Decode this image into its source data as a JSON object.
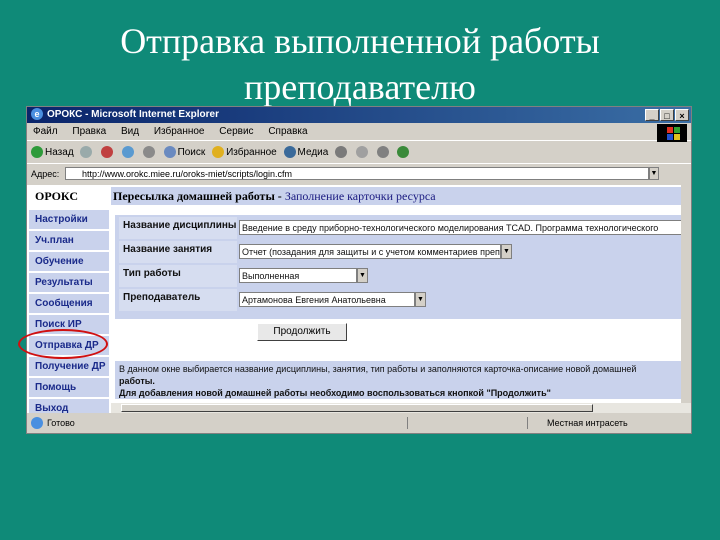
{
  "slide": {
    "title_line1": "Отправка выполненной работы",
    "title_line2": "преподавателю"
  },
  "window": {
    "title": "ОРОКС - Microsoft Internet Explorer",
    "menu": [
      "Файл",
      "Правка",
      "Вид",
      "Избранное",
      "Сервис",
      "Справка"
    ],
    "toolbar": {
      "back": "Назад",
      "search": "Поиск",
      "favorites": "Избранное",
      "media": "Медиа"
    },
    "address_label": "Адрес:",
    "address_value": "http://www.orokc.miee.ru/oroks-miet/scripts/login.cfm"
  },
  "sidebar": {
    "header": "ОРОКС",
    "items": [
      "Настройки",
      "Уч.план",
      "Обучение",
      "Результаты",
      "Сообщения",
      "Поиск ИР",
      "Отправка ДР",
      "Получение ДР",
      "Помощь",
      "Выход"
    ]
  },
  "main": {
    "header_bold": "Пересылка домашней работы -",
    "header_rest": "Заполнение карточки ресурса",
    "fields": [
      {
        "label": "Название дисциплины",
        "value": "Введение в среду приборно-технологического моделирования TCAD. Программа технологического"
      },
      {
        "label": "Название занятия",
        "value": "Отчет (позадания для защиты и с учетом комментариев преподавателя)"
      },
      {
        "label": "Тип работы",
        "value": "Выполненная"
      },
      {
        "label": "Преподаватель",
        "value": "Артамонова Евгения Анатольевна"
      }
    ],
    "continue_button": "Продолжить",
    "help_line1": "В данном окне выбирается название дисциплины, занятия, тип работы и заполняются карточка-описание новой домашней",
    "help_line2": "работы.",
    "help_line3": "Для добавления новой домашней работы необходимо воспользоваться кнопкой \"Продолжить\""
  },
  "statusbar": {
    "status": "Готово",
    "zone": "Местная интрасеть"
  },
  "colors": {
    "slide_bg": "#0f8a78",
    "panel": "#c9d2ec",
    "highlight_circle": "#d01010"
  }
}
